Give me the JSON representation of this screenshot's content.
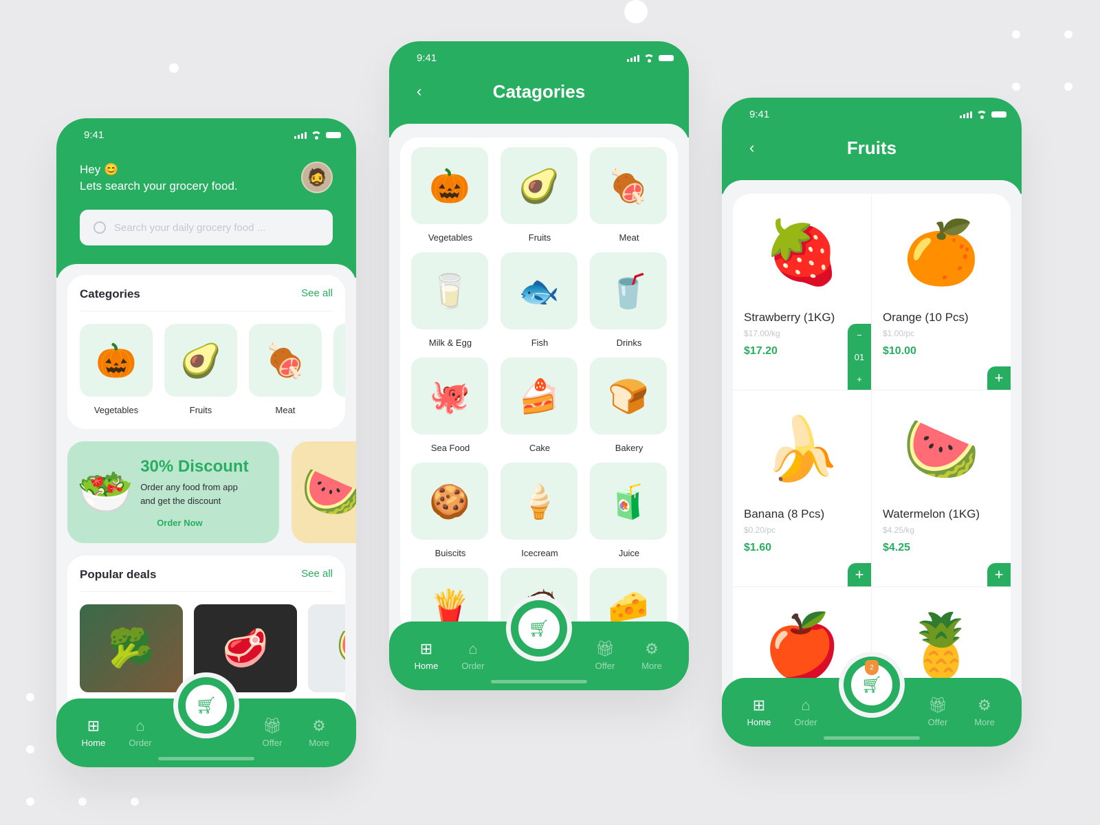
{
  "status_time": "9:41",
  "nav": {
    "home": "Home",
    "order": "Order",
    "offer": "Offer",
    "more": "More"
  },
  "home": {
    "greeting": "Hey 😊",
    "subtitle": "Lets search your grocery food.",
    "search_placeholder": "Search your daily grocery food ...",
    "categories_title": "Categories",
    "see_all": "See all",
    "categories": [
      {
        "label": "Vegetables",
        "icon": "🎃"
      },
      {
        "label": "Fruits",
        "icon": "🥑"
      },
      {
        "label": "Meat",
        "icon": "🍖"
      }
    ],
    "promo": {
      "title": "30% Discount",
      "text": "Order any food from app and get the discount",
      "cta": "Order Now"
    },
    "popular_title": "Popular deals",
    "popular_see_all": "See all"
  },
  "categories_screen": {
    "title": "Catagories",
    "items": [
      {
        "label": "Vegetables",
        "icon": "🎃"
      },
      {
        "label": "Fruits",
        "icon": "🥑"
      },
      {
        "label": "Meat",
        "icon": "🍖"
      },
      {
        "label": "Milk & Egg",
        "icon": "🥛"
      },
      {
        "label": "Fish",
        "icon": "🐟"
      },
      {
        "label": "Drinks",
        "icon": "🥤"
      },
      {
        "label": "Sea Food",
        "icon": "🐙"
      },
      {
        "label": "Cake",
        "icon": "🍰"
      },
      {
        "label": "Bakery",
        "icon": "🍞"
      },
      {
        "label": "Buiscits",
        "icon": "🍪"
      },
      {
        "label": "Icecream",
        "icon": "🍦"
      },
      {
        "label": "Juice",
        "icon": "🧃"
      },
      {
        "label": "",
        "icon": "🍟"
      },
      {
        "label": "",
        "icon": "🥥"
      },
      {
        "label": "",
        "icon": "🧀"
      }
    ]
  },
  "fruits_screen": {
    "title": "Fruits",
    "cart_count": "2",
    "items": [
      {
        "name": "Strawberry (1KG)",
        "unit": "$17.00/kg",
        "price": "$17.20",
        "icon": "🍓",
        "qty": "01"
      },
      {
        "name": "Orange (10 Pcs)",
        "unit": "$1.00/pc",
        "price": "$10.00",
        "icon": "🍊"
      },
      {
        "name": "Banana (8 Pcs)",
        "unit": "$0.20/pc",
        "price": "$1.60",
        "icon": "🍌"
      },
      {
        "name": "Watermelon (1KG)",
        "unit": "$4.25/kg",
        "price": "$4.25",
        "icon": "🍉"
      },
      {
        "name": "",
        "unit": "",
        "price": "",
        "icon": "🍎"
      },
      {
        "name": "",
        "unit": "",
        "price": "",
        "icon": "🍍"
      }
    ]
  }
}
